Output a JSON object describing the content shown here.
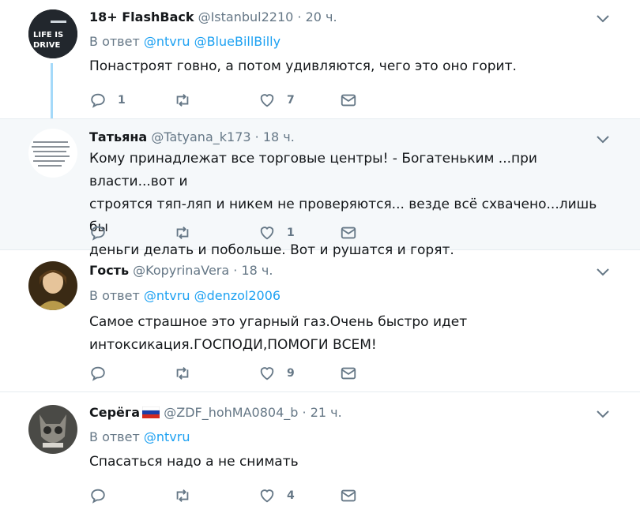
{
  "tweets": [
    {
      "name": "18+ FlashBack",
      "handle": "@Istanbul2210",
      "dot": "·",
      "time": "20 ч.",
      "reply_prefix": "В ответ",
      "mentions": [
        "@ntvru",
        "@BlueBillBilly"
      ],
      "text": "Понастроят говно, а потом удивляются, чего это оно горит.",
      "reply_count": "1",
      "retweet_count": "",
      "like_count": "7",
      "avatar_text": [
        "LIFE IS",
        "DRIVE"
      ]
    },
    {
      "name": "Татьяна",
      "handle": "@Tatyana_k173",
      "dot": "·",
      "time": "18 ч.",
      "text_lines": [
        "Кому принадлежат все торговые центры! - Богатеньким ...при власти...вот и",
        "строятся тяп-ляп и никем не проверяются... везде всё схвачено...лишь бы",
        "деньги делать и побольше. Вот и рушатся и горят."
      ],
      "reply_count": "",
      "retweet_count": "",
      "like_count": "1"
    },
    {
      "name": "Гость",
      "handle": "@KopyrinaVera",
      "dot": "·",
      "time": "18 ч.",
      "reply_prefix": "В ответ",
      "mentions": [
        "@ntvru",
        "@denzol2006"
      ],
      "text_lines": [
        "Самое страшное это угарный газ.Очень быстро идет",
        "интоксикация.ГОСПОДИ,ПОМОГИ ВСЕМ!"
      ],
      "reply_count": "",
      "retweet_count": "",
      "like_count": "9"
    },
    {
      "name": "Серёга",
      "handle": "@ZDF_hohMA0804_b",
      "dot": "·",
      "time": "21 ч.",
      "reply_prefix": "В ответ",
      "mentions": [
        "@ntvru"
      ],
      "text": "Спасаться надо а не снимать",
      "reply_count": "",
      "retweet_count": "",
      "like_count": "4"
    }
  ],
  "colors": {
    "link": "#1da1f2",
    "secondary": "#657786",
    "highlight_bg": "#f5f8fa",
    "thread_line": "#a4d9f9"
  }
}
